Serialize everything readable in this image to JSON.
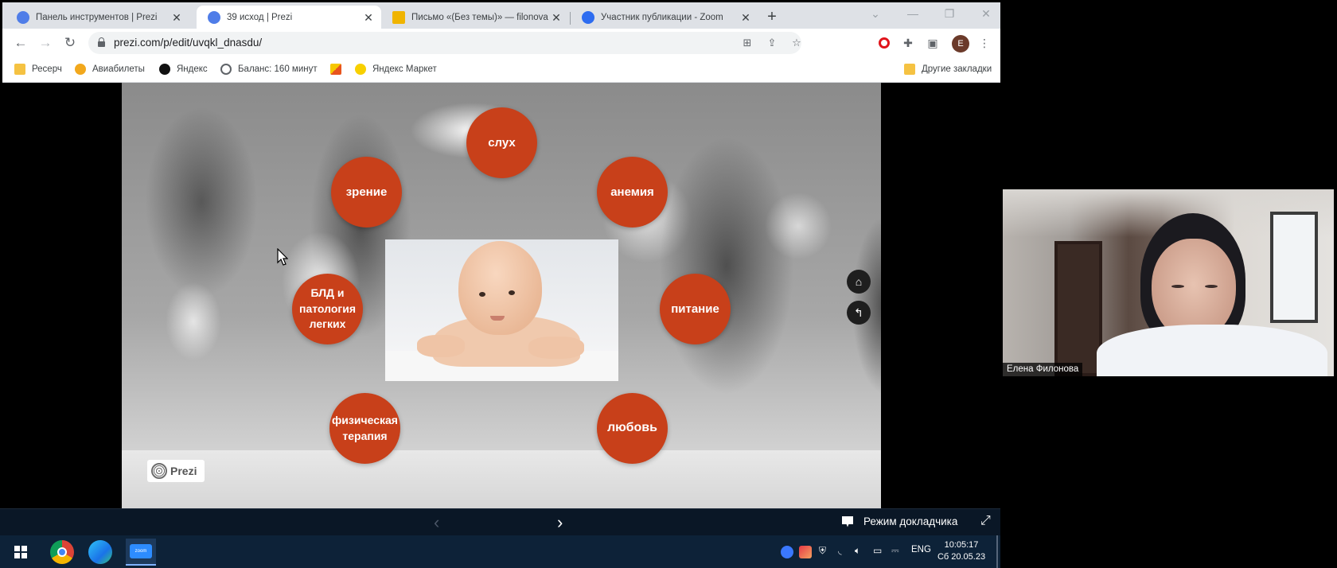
{
  "browser": {
    "tabs": [
      {
        "title": "Панель инструментов | Prezi",
        "favicon_color": "#4f7de8"
      },
      {
        "title": "39 исход | Prezi",
        "favicon_color": "#4f7de8"
      },
      {
        "title": "Письмо «(Без темы)» — filonova",
        "favicon_color": "#f0b400"
      },
      {
        "title": "Участник публикации - Zoom",
        "favicon_color": "#2d6cf0"
      }
    ],
    "url": "prezi.com/p/edit/uvqkl_dnasdu/",
    "profile_initial": "E",
    "bookmarks": [
      {
        "label": "Ресерч",
        "icon": "folder-icon"
      },
      {
        "label": "Авиабилеты",
        "icon": "aviabilety-icon"
      },
      {
        "label": "Яндекс",
        "icon": "yandex-icon"
      },
      {
        "label": "Баланс: 160 минут",
        "icon": "globe-icon"
      },
      {
        "label": "",
        "icon": "mail-icon"
      },
      {
        "label": "Яндекс Маркет",
        "icon": "market-icon"
      }
    ],
    "other_bookmarks": "Другие закладки"
  },
  "slide": {
    "bubbles": [
      {
        "id": "sluh",
        "text": "слух"
      },
      {
        "id": "zrenie",
        "text": "зрение"
      },
      {
        "id": "anemia",
        "text": "анемия"
      },
      {
        "id": "bld",
        "text": "БЛД и\nпатология\nлегких"
      },
      {
        "id": "pitanie",
        "text": "питание"
      },
      {
        "id": "fizterapia",
        "text": "физическая\nтерапия"
      },
      {
        "id": "lyubov",
        "text": "любовь"
      }
    ],
    "logo_text": "Prezi",
    "accent_color": "#c8401a"
  },
  "presentation_bar": {
    "presenter_mode_label": "Режим докладчика"
  },
  "taskbar": {
    "zoom_label": "zoom",
    "language": "ENG",
    "time": "10:05:17",
    "date": "Сб 20.05.23"
  },
  "video": {
    "participant_name": "Елена Филонова"
  }
}
